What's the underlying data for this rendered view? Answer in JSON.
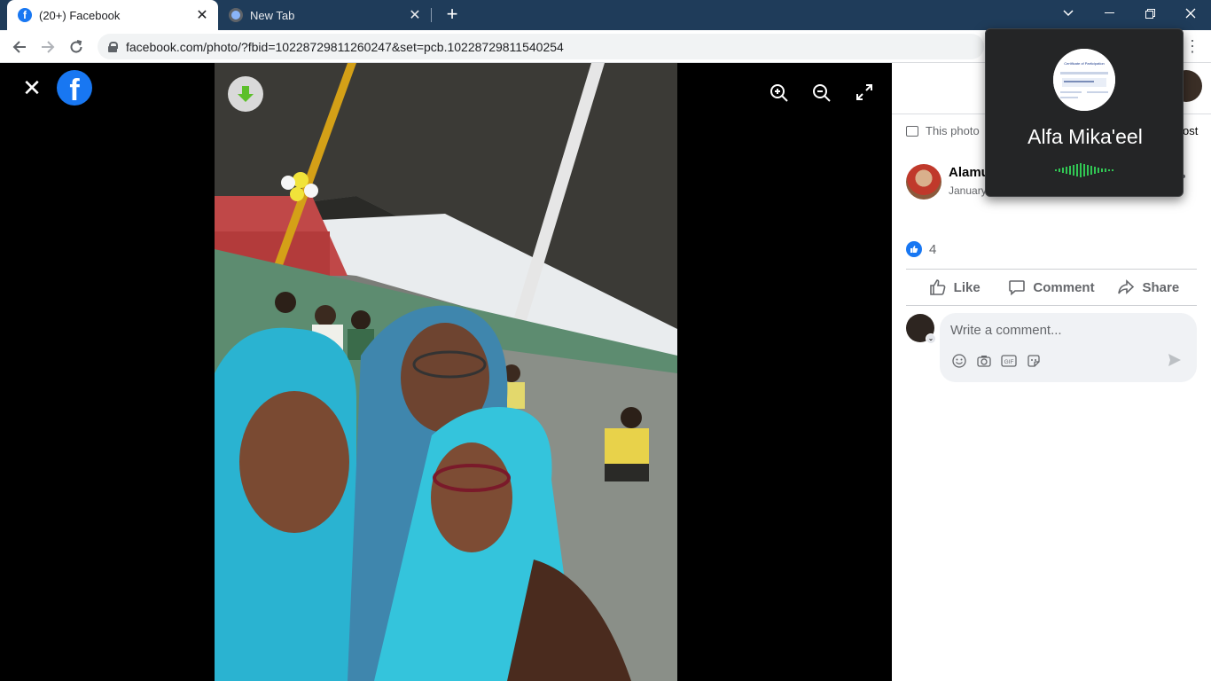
{
  "browser": {
    "tabs": [
      {
        "title": "(20+) Facebook",
        "active": true,
        "icon": "facebook-icon"
      },
      {
        "title": "New Tab",
        "active": false,
        "icon": "chrome-icon"
      }
    ],
    "new_tab_label": "+",
    "url": "facebook.com/photo/?fbid=10228729811260247&set=pcb.10228729811540254"
  },
  "viewer": {
    "close_label": "✕",
    "logo_letter": "f"
  },
  "panel": {
    "this_photo_text": "This photo",
    "post_link_text": "ost",
    "author_name": "Alamu",
    "author_date": "January",
    "reaction_count": "4",
    "actions": {
      "like": "Like",
      "comment": "Comment",
      "share": "Share"
    },
    "comment_placeholder": "Write a comment...",
    "comment_icons": [
      "emoji-icon",
      "camera-icon",
      "gif-icon",
      "sticker-icon"
    ],
    "gif_label": "GIF"
  },
  "call": {
    "caller_name": "Alfa Mika'eel",
    "avatar_doc_title": "Certificate of Participation"
  },
  "colors": {
    "facebook_blue": "#1877f2",
    "titlebar": "#1f3c5a",
    "call_wave": "#31c754"
  }
}
